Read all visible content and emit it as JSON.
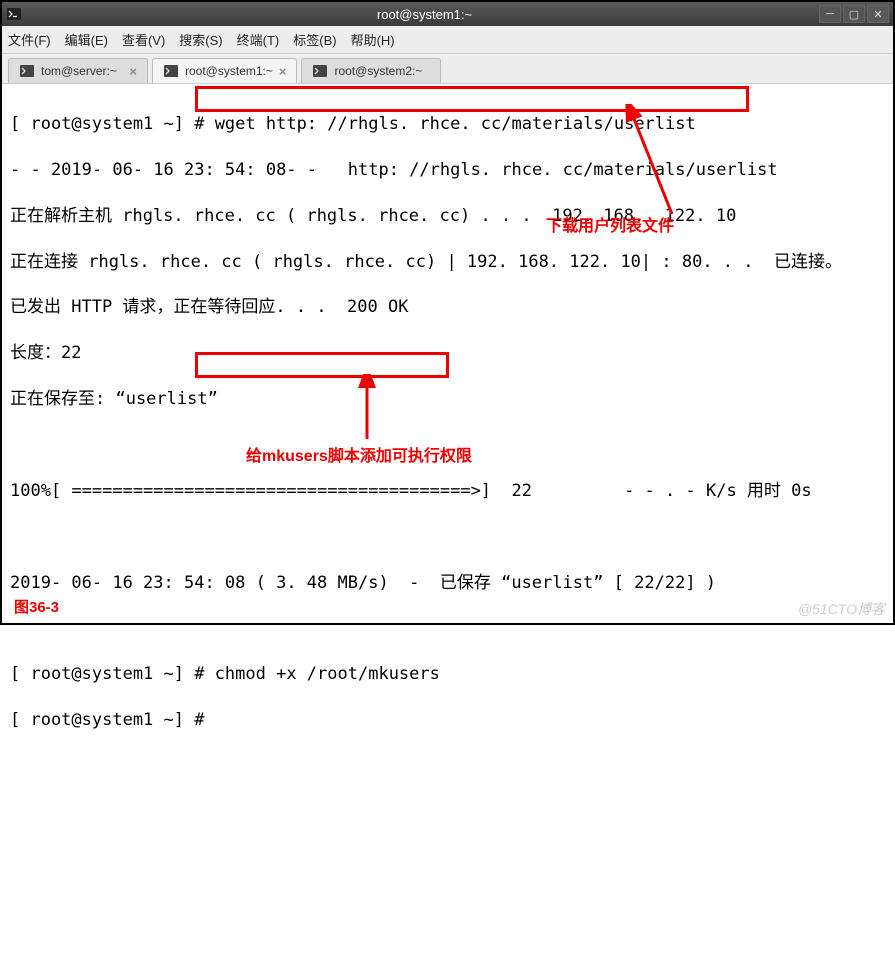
{
  "titlebar": {
    "title": "root@system1:~"
  },
  "menubar": {
    "items": [
      "文件(F)",
      "编辑(E)",
      "查看(V)",
      "搜索(S)",
      "终端(T)",
      "标签(B)",
      "帮助(H)"
    ]
  },
  "tabs": {
    "items": [
      {
        "label": "tom@server:~"
      },
      {
        "label": "root@system1:~"
      },
      {
        "label": "root@system2:~"
      }
    ]
  },
  "terminal": {
    "l0": "[ root@system1 ~] # wget http: //rhgls. rhce. cc/materials/userlist",
    "l1": "- - 2019- 06- 16 23: 54: 08- -   http: //rhgls. rhce. cc/materials/userlist",
    "l2": "正在解析主机 rhgls. rhce. cc ( rhgls. rhce. cc) . . .  192. 168.  122. 10",
    "l3": "正在连接 rhgls. rhce. cc ( rhgls. rhce. cc) | 192. 168. 122. 10| : 80. . .  已连接。",
    "l4": "已发出 HTTP 请求，正在等待回应. . .  200 OK",
    "l5": "长度：22",
    "l6": "正在保存至: “userlist”",
    "l7": " ",
    "l8": "100%[ =======================================>]  22         - - . - K/s 用时 0s",
    "l9": " ",
    "l10": "2019- 06- 16 23: 54: 08 ( 3. 48 MB/s)  -  已保存 “userlist” [ 22/22] )",
    "l11": " ",
    "l12": "[ root@system1 ~] # chmod +x /root/mkusers",
    "l13": "[ root@system1 ~] #"
  },
  "annotations": {
    "a1": "下载用户列表文件",
    "a2": "给mkusers脚本添加可执行权限",
    "figure": "图36-3",
    "watermark": "@51CTO博客"
  }
}
